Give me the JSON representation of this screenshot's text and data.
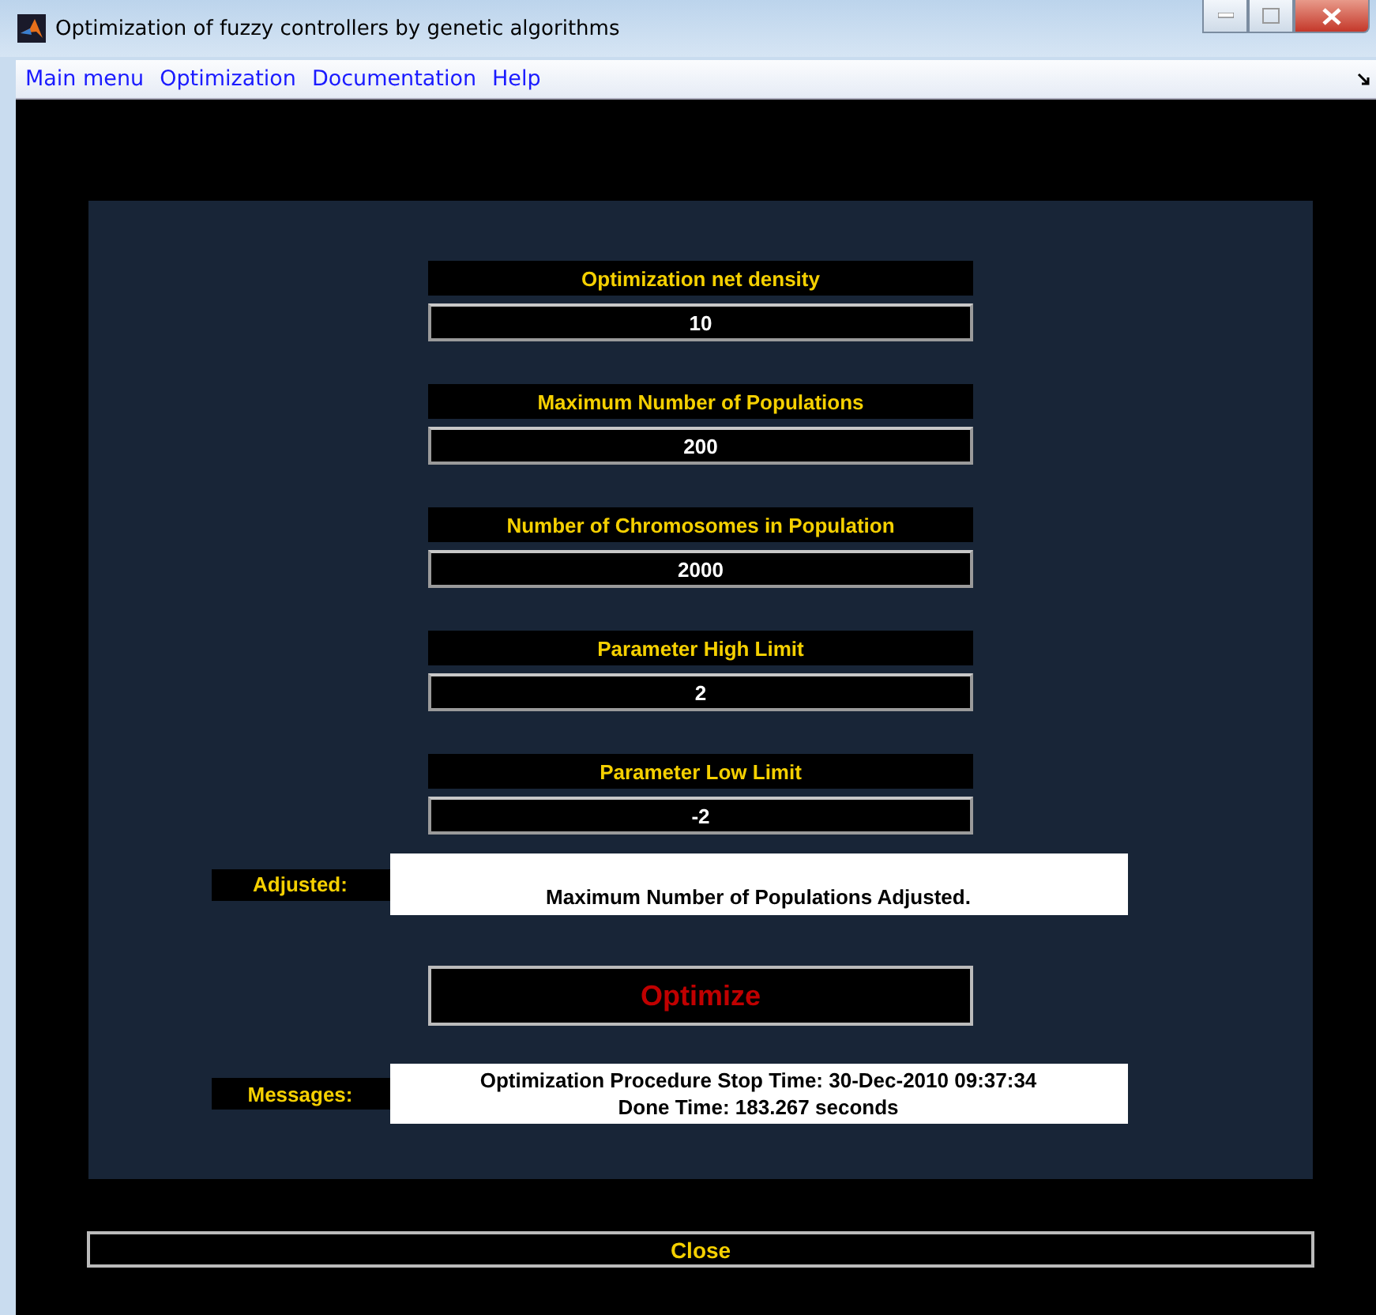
{
  "window": {
    "title": "Optimization of fuzzy controllers by genetic algorithms"
  },
  "menu": [
    "Main menu",
    "Optimization",
    "Documentation",
    "Help"
  ],
  "parameters": [
    {
      "label": "Optimization net density",
      "value": "10"
    },
    {
      "label": "Maximum Number of Populations",
      "value": "200"
    },
    {
      "label": "Number of Chromosomes in Population",
      "value": "2000"
    },
    {
      "label": "Parameter High Limit",
      "value": "2"
    },
    {
      "label": "Parameter Low Limit",
      "value": "-2"
    }
  ],
  "adjusted": {
    "label": "Adjusted:",
    "text": "Maximum Number of Populations Adjusted."
  },
  "optimize_button": "Optimize",
  "messages": {
    "label": "Messages:",
    "lines": [
      "Optimization Procedure Stop Time: 30-Dec-2010 09:37:34",
      "Done Time: 183.267 seconds"
    ]
  },
  "close_button": "Close"
}
